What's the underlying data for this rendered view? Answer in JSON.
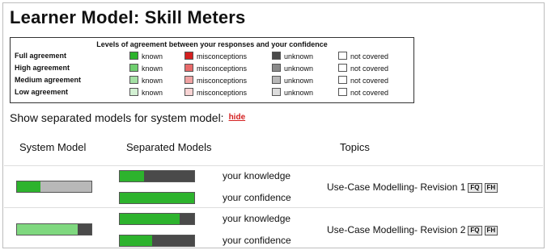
{
  "title": "Learner Model: Skill Meters",
  "legend": {
    "heading": "Levels of agreement between your responses and your confidence",
    "rows": [
      {
        "name": "Full agreement",
        "known": "known",
        "misconceptions": "misconceptions",
        "unknown": "unknown",
        "not_covered": "not covered",
        "colors": {
          "known": "#2db32d",
          "misconceptions": "#d42020",
          "unknown": "#4a4a4a",
          "not_covered": "#ffffff"
        }
      },
      {
        "name": "High agreement",
        "known": "known",
        "misconceptions": "misconceptions",
        "unknown": "unknown",
        "not_covered": "not covered",
        "colors": {
          "known": "#6fcf6f",
          "misconceptions": "#e86a6a",
          "unknown": "#8a8a8a",
          "not_covered": "#ffffff"
        }
      },
      {
        "name": "Medium agreement",
        "known": "known",
        "misconceptions": "misconceptions",
        "unknown": "unknown",
        "not_covered": "not covered",
        "colors": {
          "known": "#a3e0a3",
          "misconceptions": "#f1a3a3",
          "unknown": "#b8b8b8",
          "not_covered": "#ffffff"
        }
      },
      {
        "name": "Low agreement",
        "known": "known",
        "misconceptions": "misconceptions",
        "unknown": "unknown",
        "not_covered": "not covered",
        "colors": {
          "known": "#d3f1d3",
          "misconceptions": "#f8d3d3",
          "unknown": "#dcdcdc",
          "not_covered": "#ffffff"
        }
      }
    ]
  },
  "show_separated": {
    "text": "Show separated models for system model:",
    "link": "hide"
  },
  "columns": {
    "system": "System Model",
    "separated": "Separated Models",
    "topics": "Topics"
  },
  "topics": [
    {
      "topic": "Use-Case Modelling- Revision 1",
      "buttons": [
        "FQ",
        "FH"
      ],
      "system_model": {
        "known": 0.32,
        "known_color": "#2db32d",
        "unknown_color": "#b8b8b8"
      },
      "knowledge_label": "your knowledge",
      "knowledge": {
        "known": 0.33,
        "known_color": "#2db32d",
        "unknown_color": "#4a4a4a"
      },
      "confidence_label": "your confidence",
      "confidence": {
        "known": 1.0,
        "known_color": "#2db32d",
        "unknown_color": "#4a4a4a"
      }
    },
    {
      "topic": "Use-Case Modelling- Revision 2",
      "buttons": [
        "FQ",
        "FH"
      ],
      "system_model": {
        "known": 0.82,
        "known_color": "#7fd87f",
        "unknown_color": "#4a4a4a"
      },
      "knowledge_label": "your knowledge",
      "knowledge": {
        "known": 0.8,
        "known_color": "#2db32d",
        "unknown_color": "#4a4a4a"
      },
      "confidence_label": "your confidence",
      "confidence": {
        "known": 0.43,
        "known_color": "#2db32d",
        "unknown_color": "#4a4a4a"
      }
    }
  ]
}
